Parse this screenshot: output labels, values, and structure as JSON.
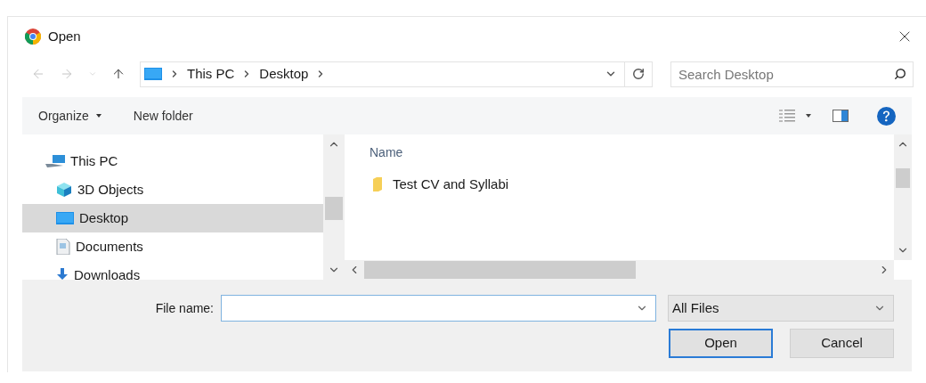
{
  "window": {
    "title": "Open"
  },
  "navigation": [
    {
      "kind": "back",
      "disabled": true
    },
    {
      "kind": "forward",
      "disabled": true
    },
    {
      "kind": "recent",
      "disabled": true
    },
    {
      "kind": "up",
      "disabled": false
    }
  ],
  "breadcrumb": [
    "This PC",
    "Desktop"
  ],
  "search": {
    "placeholder": "Search Desktop"
  },
  "toolbar": {
    "organize": "Organize",
    "new_folder": "New folder"
  },
  "nav_pane": {
    "items": [
      {
        "label": "This PC",
        "kind": "pc",
        "selected": false
      },
      {
        "label": "3D Objects",
        "kind": "cube",
        "selected": false
      },
      {
        "label": "Desktop",
        "kind": "desktop",
        "selected": true
      },
      {
        "label": "Documents",
        "kind": "documents",
        "selected": false
      },
      {
        "label": "Downloads",
        "kind": "downloads",
        "selected": false
      }
    ]
  },
  "file_list": {
    "columns": [
      "Name"
    ],
    "rows": [
      {
        "name": "Test CV and Syllabi",
        "kind": "folder"
      }
    ]
  },
  "file_name": {
    "label": "File name:"
  },
  "file_type": {
    "value": "All Files"
  },
  "buttons": [
    {
      "label": "Open",
      "default": true
    },
    {
      "label": "Cancel",
      "default": false
    }
  ]
}
